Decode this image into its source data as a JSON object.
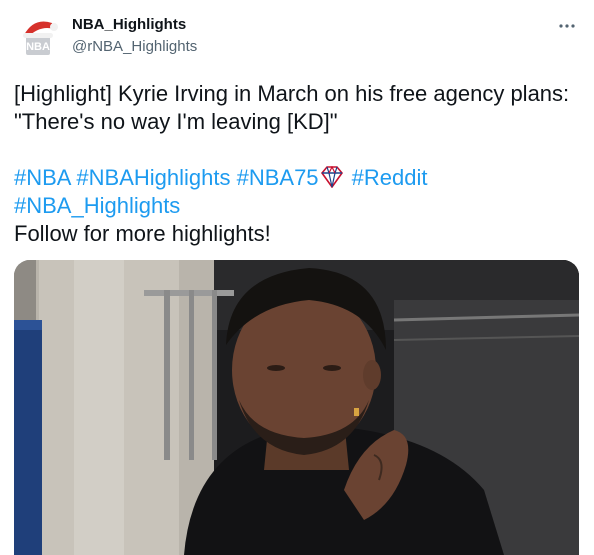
{
  "author": {
    "display_name": "NBA_Highlights",
    "handle": "@rNBA_Highlights",
    "avatar_icon": "nba-santa-hat-avatar"
  },
  "menu": {
    "icon": "more-options-icon"
  },
  "tweet": {
    "line1": "[Highlight] Kyrie Irving in March on his free agency plans: \"There's no way I'm leaving [KD]\"",
    "hashtags_line1": [
      "#NBA",
      "#NBAHighlights",
      "#NBA75",
      "#Reddit"
    ],
    "hashtags_line2": [
      "#NBA_Highlights"
    ],
    "nba75_emoji": "nba-75-diamond-emoji",
    "closing": "Follow for more highlights!"
  },
  "media": {
    "type": "video-thumbnail",
    "icon": "video-thumbnail-kyrie-irving"
  },
  "colors": {
    "text": "#0f1419",
    "secondary": "#536471",
    "link": "#1d9bf0",
    "background": "#ffffff"
  }
}
